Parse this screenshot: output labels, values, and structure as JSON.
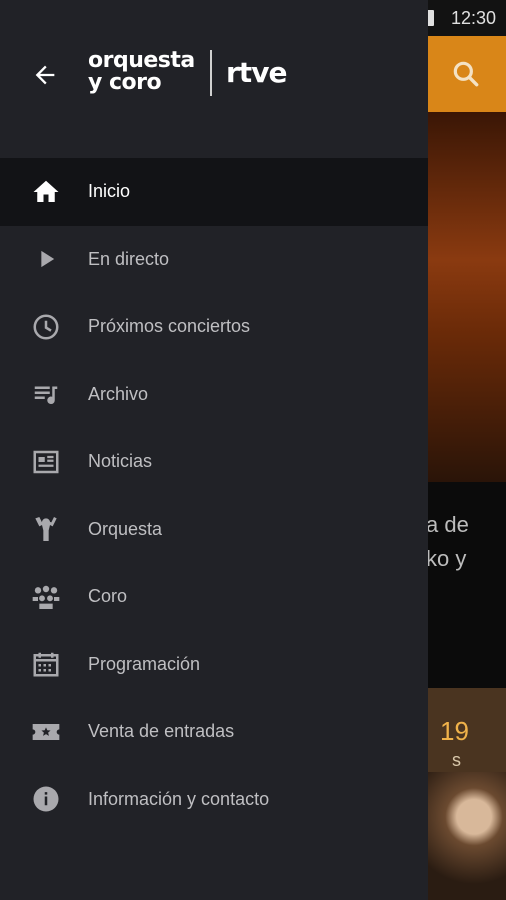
{
  "status": {
    "time": "12:30"
  },
  "header": {
    "logo_line1": "orquesta",
    "logo_line2": "y coro",
    "brand": "rtve"
  },
  "background": {
    "hero_text_line1": "a de",
    "hero_text_line2": "ko y",
    "date_number": "19",
    "date_suffix": "s"
  },
  "menu": {
    "items": [
      {
        "label": "Inicio",
        "icon": "home-icon",
        "active": true
      },
      {
        "label": "En directo",
        "icon": "play-icon"
      },
      {
        "label": "Próximos conciertos",
        "icon": "clock-icon"
      },
      {
        "label": "Archivo",
        "icon": "playlist-icon"
      },
      {
        "label": "Noticias",
        "icon": "newspaper-icon"
      },
      {
        "label": "Orquesta",
        "icon": "conductor-icon"
      },
      {
        "label": "Coro",
        "icon": "choir-icon"
      },
      {
        "label": "Programación",
        "icon": "calendar-icon"
      },
      {
        "label": "Venta de entradas",
        "icon": "ticket-icon"
      },
      {
        "label": "Información y contacto",
        "icon": "info-icon"
      }
    ]
  },
  "colors": {
    "toolbar": "#d98618",
    "drawer": "#212227",
    "active_row": "#121316",
    "label": "#bfbfc2",
    "icon": "#a9a9ad"
  }
}
